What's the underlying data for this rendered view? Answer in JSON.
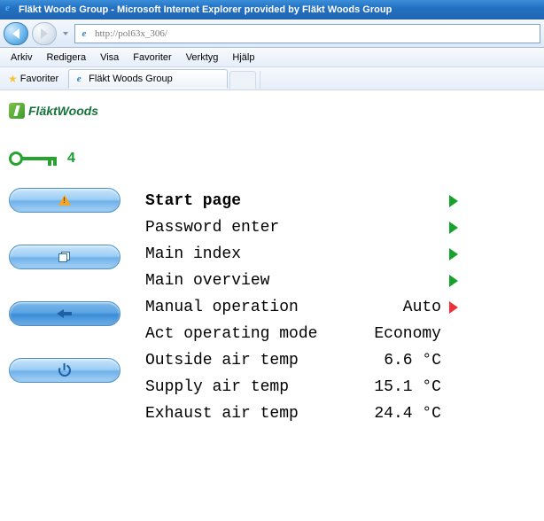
{
  "window": {
    "title": "Fläkt Woods Group - Microsoft Internet Explorer provided by Fläkt Woods Group"
  },
  "address": {
    "url": "http://pol63x_306/"
  },
  "menu": {
    "items": [
      "Arkiv",
      "Redigera",
      "Visa",
      "Favoriter",
      "Verktyg",
      "Hjälp"
    ]
  },
  "favbar": {
    "label": "Favoriter",
    "tab_title": "Fläkt Woods Group"
  },
  "brand": {
    "name": "FläktWoods"
  },
  "key": {
    "level": "4"
  },
  "rows": [
    {
      "label": "Start page",
      "value": "",
      "arrow": "green",
      "head": true
    },
    {
      "label": "Password enter",
      "value": "",
      "arrow": "green"
    },
    {
      "label": "Main index",
      "value": "",
      "arrow": "green"
    },
    {
      "label": "Main overview",
      "value": "",
      "arrow": "green"
    },
    {
      "label": "Manual operation",
      "value": "Auto",
      "arrow": "red"
    },
    {
      "label": "Act operating mode",
      "value": "Economy",
      "arrow": ""
    },
    {
      "label": "Outside air temp",
      "value": "6.6 °C",
      "arrow": ""
    },
    {
      "label": "Supply air temp",
      "value": "15.1 °C",
      "arrow": ""
    },
    {
      "label": "Exhaust air temp",
      "value": "24.4 °C",
      "arrow": ""
    }
  ]
}
